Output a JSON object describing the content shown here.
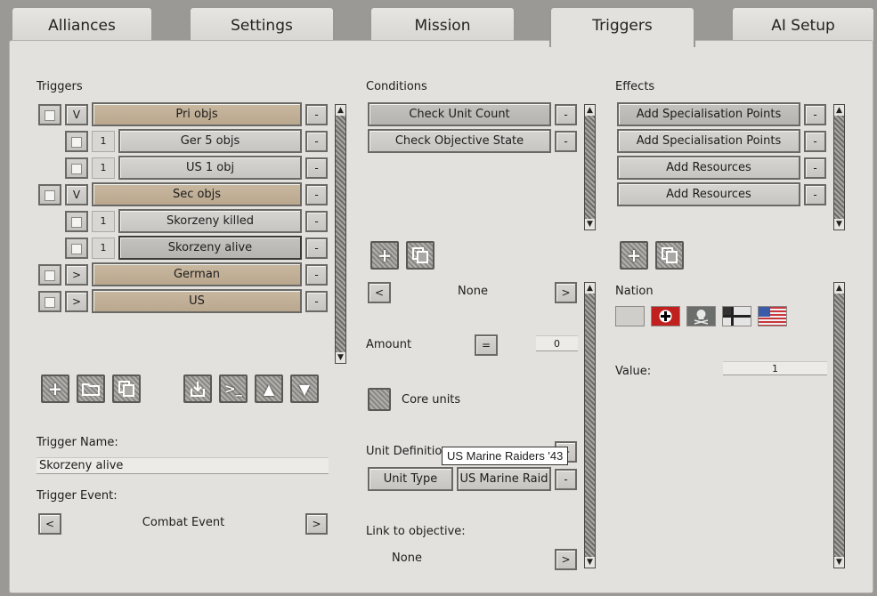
{
  "tabs": [
    {
      "label": "Alliances"
    },
    {
      "label": "Settings"
    },
    {
      "label": "Mission"
    },
    {
      "label": "Triggers"
    },
    {
      "label": "AI Setup"
    }
  ],
  "active_tab": "Triggers",
  "triggers": {
    "heading": "Triggers",
    "rows": [
      {
        "indicator": "V",
        "label": "Pri objs"
      },
      {
        "indicator": "1",
        "label": "Ger 5 objs"
      },
      {
        "indicator": "1",
        "label": "US 1 obj"
      },
      {
        "indicator": "V",
        "label": "Sec objs"
      },
      {
        "indicator": "1",
        "label": "Skorzeny killed"
      },
      {
        "indicator": "1",
        "label": "Skorzeny alive"
      },
      {
        "indicator": ">",
        "label": "German"
      },
      {
        "indicator": ">",
        "label": "US"
      }
    ],
    "remove_label": "-",
    "name_label": "Trigger Name:",
    "name_value": "Skorzeny alive",
    "event_label": "Trigger Event:",
    "event_value": "Combat Event",
    "prev": "<",
    "next": ">"
  },
  "conditions": {
    "heading": "Conditions",
    "items": [
      "Check Unit Count",
      "Check Objective State"
    ],
    "remove_label": "-",
    "selector_value": "None",
    "prev": "<",
    "next": ">",
    "amount_label": "Amount",
    "amount_operator": "=",
    "amount_value": "0",
    "core_units_label": "Core units",
    "unit_definition_label": "Unit Definition",
    "unit_definition_add": "+",
    "unit_type_label": "Unit Type",
    "unit_value": "US Marine Raid",
    "unit_remove": "-",
    "tooltip": "US Marine Raiders '43",
    "link_label": "Link to objective:",
    "link_value": "None"
  },
  "effects": {
    "heading": "Effects",
    "items": [
      "Add Specialisation Points",
      "Add Specialisation Points",
      "Add Resources",
      "Add Resources"
    ],
    "remove_label": "-",
    "nation_label": "Nation",
    "nations": [
      "none-flag",
      "german-reich-flag",
      "ss-flag",
      "reich-war-flag",
      "us-flag"
    ],
    "value_label": "Value:",
    "value": "1"
  },
  "colors": {
    "panel": "#e2e1dd",
    "tan_button": "#c2b196",
    "gray_button": "#cbcac6",
    "border": "#6a6965"
  }
}
